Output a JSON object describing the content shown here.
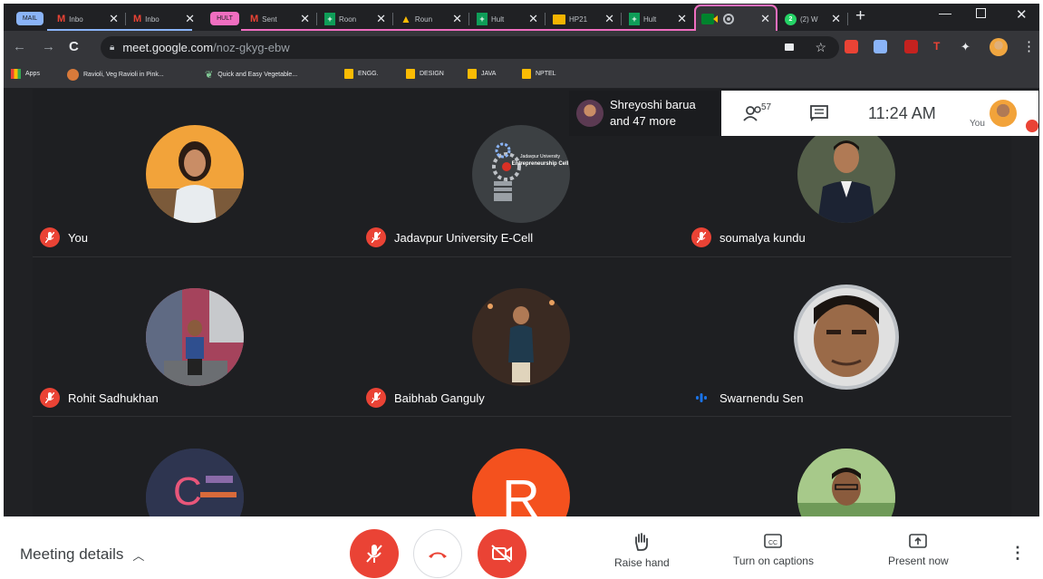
{
  "browser": {
    "tabs": [
      {
        "title": "MAIL",
        "kind": "group",
        "color": "#8ab4f8"
      },
      {
        "title": "Inbo",
        "kind": "gmail"
      },
      {
        "title": "Inbo",
        "kind": "gmail"
      },
      {
        "title": "HULT",
        "kind": "group",
        "color": "#f06ec0"
      },
      {
        "title": "Sent",
        "kind": "gmail"
      },
      {
        "title": "Roon",
        "kind": "sheets"
      },
      {
        "title": "Roun",
        "kind": "drive"
      },
      {
        "title": "Hult",
        "kind": "sheets"
      },
      {
        "title": "HP21",
        "kind": "slides"
      },
      {
        "title": "Hult",
        "kind": "sheets"
      },
      {
        "title": "",
        "kind": "meet",
        "active": true
      },
      {
        "title": "(2) W",
        "kind": "whatsapp"
      }
    ],
    "url_host": "meet.google.com",
    "url_path": "/noz-gkyg-ebw",
    "bookmarks": [
      {
        "label": "Apps",
        "icon": "apps-grid-icon"
      },
      {
        "label": "Ravioli, Veg Ravioli in Pink...",
        "icon": "recipe-avatar-icon"
      },
      {
        "label": "Quick and Easy Vegetable...",
        "icon": "leaf-icon"
      },
      {
        "label": "ENGG.",
        "icon": "folder-icon"
      },
      {
        "label": "DESIGN",
        "icon": "folder-icon"
      },
      {
        "label": "JAVA",
        "icon": "folder-icon"
      },
      {
        "label": "NPTEL",
        "icon": "folder-icon"
      }
    ]
  },
  "meet": {
    "presenter": {
      "name": "Shreyoshi barua",
      "others": "and 47 more"
    },
    "participant_count": "57",
    "time": "11:24 AM",
    "self_label": "You",
    "participants": [
      {
        "name": "You",
        "mic": "off"
      },
      {
        "name": "Jadavpur University E-Cell",
        "mic": "off"
      },
      {
        "name": "soumalya kundu",
        "mic": "off"
      },
      {
        "name": "Rohit Sadhukhan",
        "mic": "off"
      },
      {
        "name": "Baibhab Ganguly",
        "mic": "off"
      },
      {
        "name": "Swarnendu Sen",
        "mic": "speaking"
      },
      {
        "name": "",
        "mic": "none"
      },
      {
        "name": "",
        "mic": "none",
        "initial": "R"
      },
      {
        "name": "",
        "mic": "none"
      }
    ],
    "ecell_logo_text": "Entrepreneurship Cell",
    "ecell_logo_subtext": "Jadavpur University",
    "tile_c_letter": "C",
    "controls": {
      "meeting_details": "Meeting details",
      "raise_hand": "Raise hand",
      "captions": "Turn on captions",
      "present": "Present now"
    },
    "colors": {
      "hangup": "#ea4335",
      "avatar_r": "#f4511e",
      "stage": "#202124"
    }
  }
}
